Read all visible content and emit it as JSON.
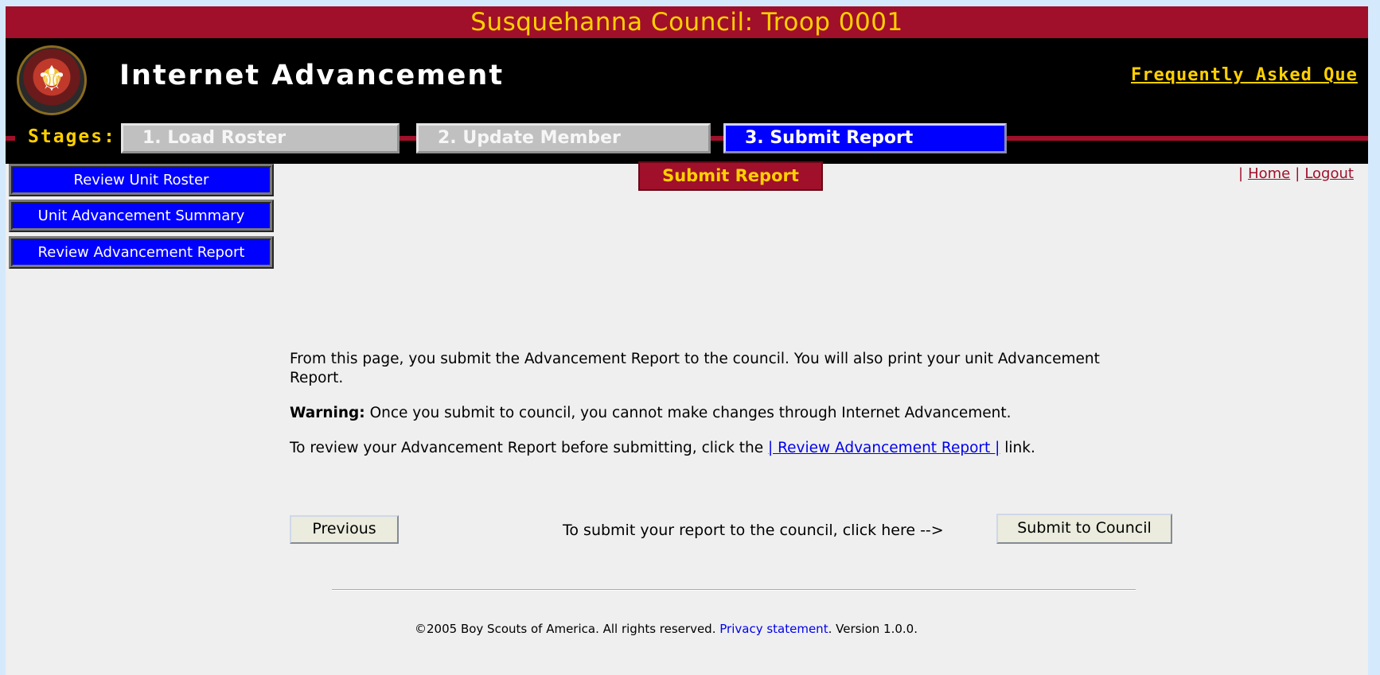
{
  "title_bar": "Susquehanna Council: Troop 0001",
  "header": {
    "app_title": "Internet Advancement",
    "faq_link": "Frequently Asked Que"
  },
  "stages": {
    "label": "Stages:",
    "items": [
      {
        "label": "1. Load Roster",
        "state": "inactive"
      },
      {
        "label": "2. Update Member",
        "state": "inactive"
      },
      {
        "label": "3. Submit Report",
        "state": "active"
      }
    ]
  },
  "nav": {
    "items": [
      {
        "label": "Review Unit Roster"
      },
      {
        "label": "Unit Advancement Summary"
      },
      {
        "label": "Review Advancement Report"
      }
    ]
  },
  "section_title": "Submit Report",
  "top_links": {
    "home": "Home",
    "logout": "Logout",
    "separator": "|"
  },
  "content": {
    "intro": "From this page, you submit the Advancement Report to the council. You will also print your unit Advancement Report.",
    "warning_label": "Warning:",
    "warning_text": " Once you submit to council, you cannot make changes through Internet Advancement.",
    "review_text_before": "To review your Advancement Report before submitting, click the ",
    "review_link": "| Review Advancement Report |",
    "review_text_after": " link."
  },
  "actions": {
    "previous_label": "Previous",
    "submit_prompt": "To submit your report to the council, click here -->",
    "submit_label": "Submit to Council"
  },
  "footer": {
    "copyright": "©2005 Boy Scouts of America. All rights reserved.",
    "privacy_link": "Privacy statement",
    "version": ". Version 1.0.0."
  },
  "colors": {
    "brand_red": "#a0102a",
    "brand_gold": "#ffd000",
    "active_blue": "#0000ff",
    "page_bg": "#efefef"
  }
}
